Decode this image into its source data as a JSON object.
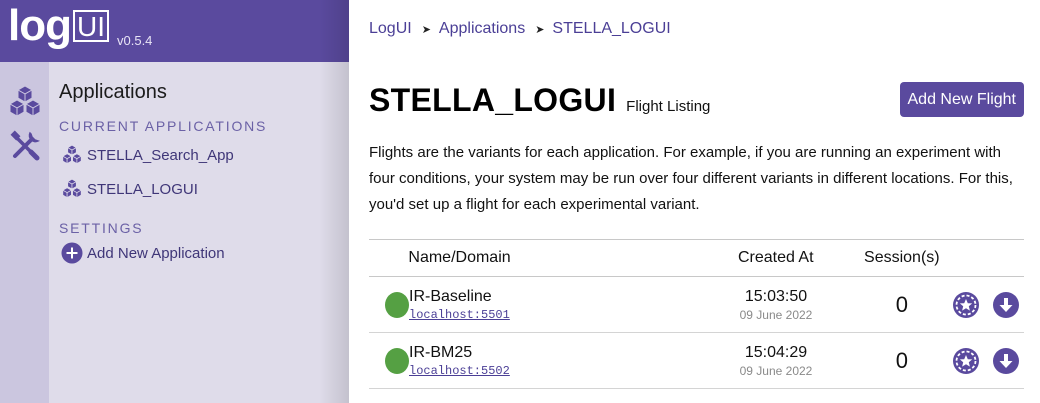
{
  "brand": {
    "logo_log": "log",
    "logo_ui": "UI",
    "version": "v0.5.4"
  },
  "sidebar": {
    "title": "Applications",
    "current_label": "CURRENT APPLICATIONS",
    "apps": [
      {
        "label": "STELLA_Search_App",
        "icon": "cubes-icon"
      },
      {
        "label": "STELLA_LOGUI",
        "icon": "cubes-icon"
      }
    ],
    "settings_label": "SETTINGS",
    "add_app_label": "Add New Application"
  },
  "breadcrumb": [
    "LogUI",
    "Applications",
    "STELLA_LOGUI"
  ],
  "page": {
    "title": "STELLA_LOGUI",
    "subtitle": "Flight Listing",
    "add_button": "Add New Flight",
    "description": "Flights are the variants for each application. For example, if you are running an experiment with four conditions, your system may be run over four different variants in different locations. For this, you'd set up a flight for each experimental variant."
  },
  "table": {
    "headers": {
      "name": "Name/Domain",
      "created": "Created At",
      "sessions": "Session(s)"
    },
    "rows": [
      {
        "status_color": "#55a043",
        "name": "IR-Baseline",
        "domain": "localhost:5501",
        "time": "15:03:50",
        "date": "09 June 2022",
        "sessions": "0"
      },
      {
        "status_color": "#55a043",
        "name": "IR-BM25",
        "domain": "localhost:5502",
        "time": "15:04:29",
        "date": "09 June 2022",
        "sessions": "0"
      }
    ]
  },
  "colors": {
    "accent": "#5a4a9e",
    "status_active": "#55a043"
  }
}
